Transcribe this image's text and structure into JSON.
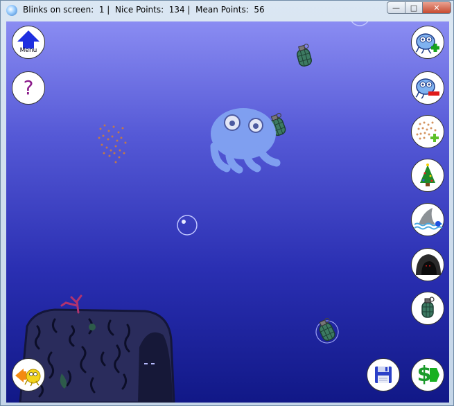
{
  "window": {
    "title": "Blinks on screen:  1 |  Nice Points:  134 |  Mean Points:  56"
  },
  "toolbar_left": {
    "menu_label": "Menu",
    "help_label": "?"
  },
  "toolbar_right": {
    "buttons": [
      "add-blink",
      "remove-blink",
      "add-food",
      "christmas-tree",
      "shark",
      "cave",
      "grenade"
    ]
  },
  "bottom_right": {
    "dollar_label": "$"
  },
  "colors": {
    "water_top": "#8a8cf2",
    "water_bottom": "#111887",
    "blink_body": "#7f9ff0",
    "rock": "#2a2c5c"
  }
}
